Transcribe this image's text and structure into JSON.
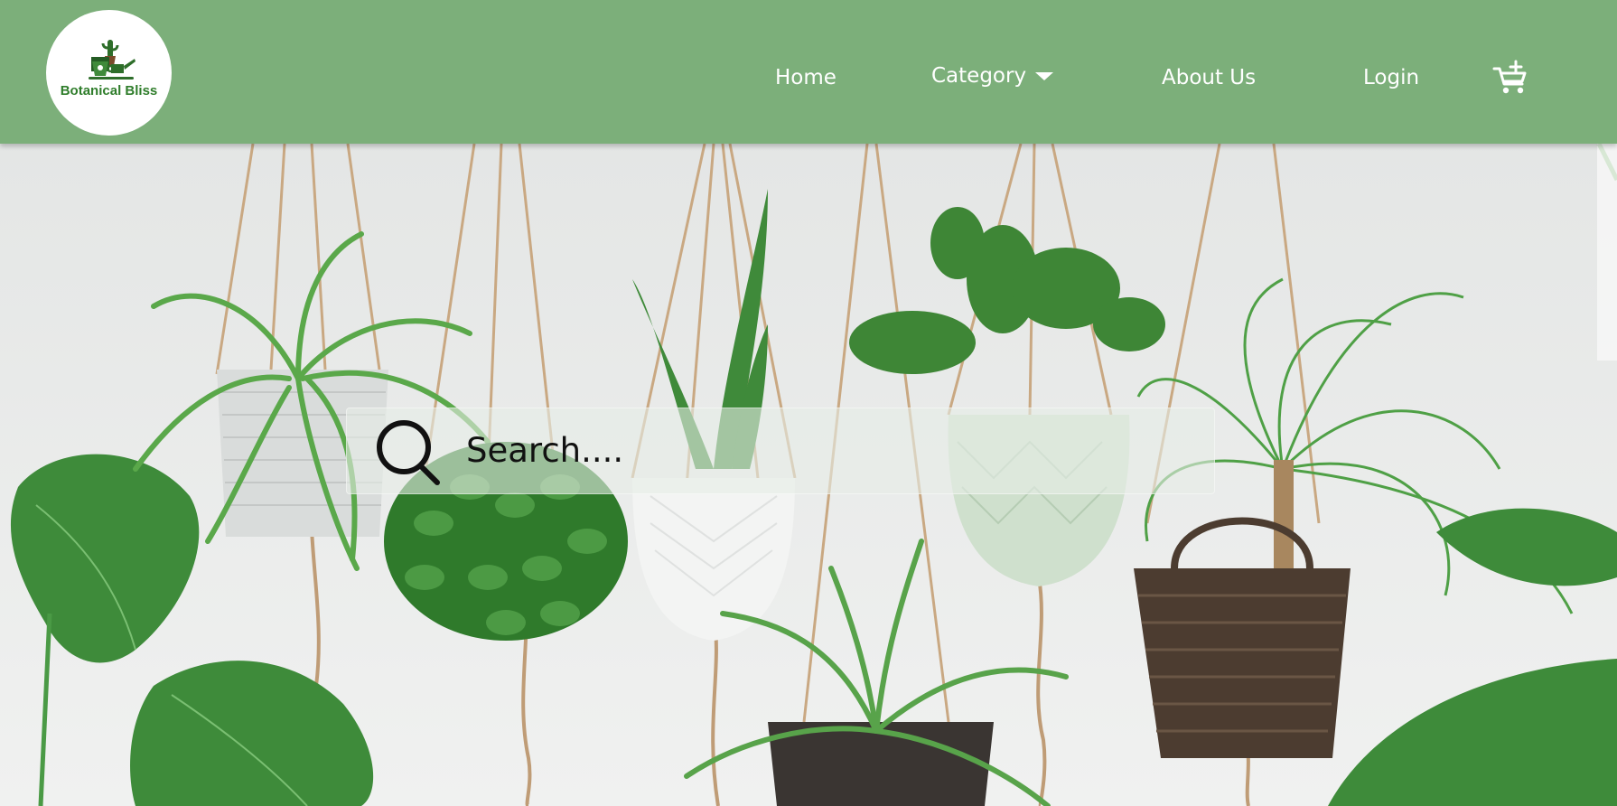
{
  "brand": {
    "name": "Botanical Bliss",
    "text_color": "#2f7d2b"
  },
  "header": {
    "background": "#7caf7a"
  },
  "nav": {
    "home": "Home",
    "category": "Category",
    "about": "About Us",
    "login": "Login"
  },
  "icons": {
    "logo": "plant-watering-can-logo",
    "caret": "caret-down-icon",
    "cart": "cart-add-icon",
    "search": "search-icon"
  },
  "search": {
    "placeholder": "Search...."
  }
}
